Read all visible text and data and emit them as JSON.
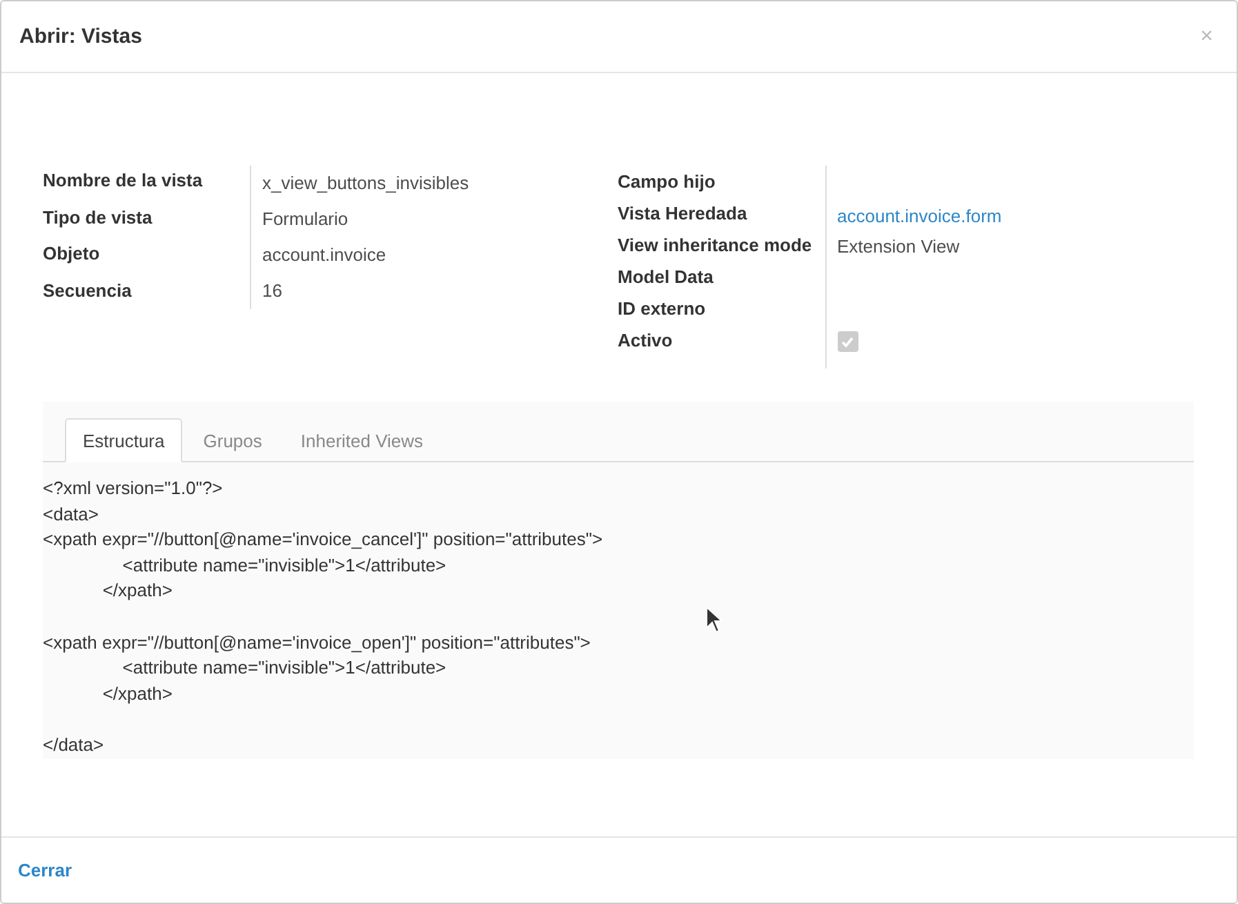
{
  "dialog": {
    "title": "Abrir: Vistas",
    "close": "×"
  },
  "left_fields": [
    {
      "label": "Nombre de la vista",
      "kind": "text",
      "value": "x_view_buttons_invisibles"
    },
    {
      "label": "Tipo de vista",
      "kind": "text",
      "value": "Formulario"
    },
    {
      "label": "Objeto",
      "kind": "text",
      "value": "account.invoice"
    },
    {
      "label": "Secuencia",
      "kind": "text",
      "value": "16"
    }
  ],
  "right_fields": [
    {
      "label": "Campo hijo",
      "kind": "empty"
    },
    {
      "label": "Vista Heredada",
      "kind": "link",
      "value": "account.invoice.form"
    },
    {
      "label": "View inheritance mode",
      "kind": "text",
      "value": "Extension View"
    },
    {
      "label": "Model Data",
      "kind": "empty"
    },
    {
      "label": "ID externo",
      "kind": "empty"
    },
    {
      "label": "Activo",
      "kind": "checkbox",
      "checked": true,
      "disabled": true
    }
  ],
  "tabs": [
    {
      "label": "Estructura",
      "selected": true
    },
    {
      "label": "Grupos",
      "selected": false
    },
    {
      "label": "Inherited Views",
      "selected": false
    }
  ],
  "code": "<?xml version=\"1.0\"?>\n<data>\n<xpath expr=\"//button[@name='invoice_cancel']\" position=\"attributes\">\n                <attribute name=\"invisible\">1</attribute>\n            </xpath>\n\n<xpath expr=\"//button[@name='invoice_open']\" position=\"attributes\">\n                <attribute name=\"invisible\">1</attribute>\n            </xpath>\n\n</data>",
  "footer": {
    "button": "Cerrar"
  }
}
